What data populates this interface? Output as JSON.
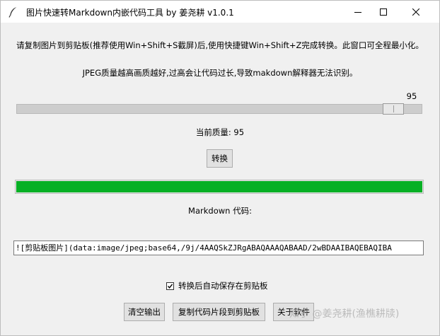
{
  "window": {
    "title": "图片快速转Markdown内嵌代码工具 by 姜尧耕 v1.0.1",
    "icon": "feather-icon"
  },
  "instructions": {
    "line1": "请复制图片到剪贴板(推荐使用Win+Shift+S截屏)后,使用快捷键Win+Shift+Z完成转换。此窗口可全程最小化。",
    "line2": "JPEG质量越高画质越好,过高会让代码过长,导致makdown解释器无法识别。"
  },
  "quality": {
    "slider_value": "95",
    "slider_level": 0.95,
    "current_label": "当前质量: 95"
  },
  "convert_button": "转换",
  "progress": {
    "value": 1.0,
    "color": "#06b025"
  },
  "code_label": "Markdown 代码:",
  "code_output": "![剪贴板图片](data:image/jpeg;base64,/9j/4AAQSkZJRgABAQAAAQABAAD/2wBDAAIBAQEBAQIBA",
  "auto_save": {
    "label": "转换后自动保存在剪贴板",
    "checked": true
  },
  "buttons": {
    "clear": "清空输出",
    "copy": "复制代码片段到剪贴板",
    "about": "关于软件"
  },
  "watermark": "知乎 @姜尧耕(渔樵耕牍)"
}
